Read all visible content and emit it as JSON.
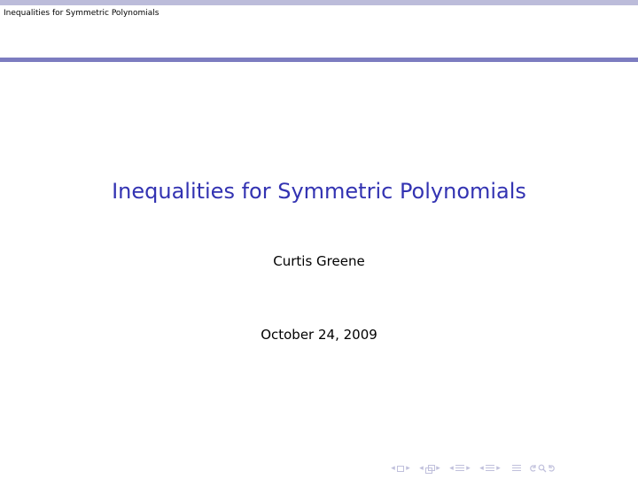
{
  "header": {
    "short_title": "Inequalities for Symmetric Polynomials"
  },
  "slide": {
    "title": "Inequalities for Symmetric Polynomials",
    "author": "Curtis Greene",
    "date": "October 24, 2009"
  },
  "colors": {
    "title": "#3333b2",
    "header_rule": "#7c7cc0",
    "top_rule": "#bcbcda",
    "nav": "#c0c0dc"
  },
  "navigation": {
    "groups": [
      "slide-nav",
      "frame-nav",
      "subsection-nav",
      "section-nav",
      "align-icon",
      "search-nav"
    ],
    "left_arrow": "◂",
    "right_arrow": "▸"
  }
}
